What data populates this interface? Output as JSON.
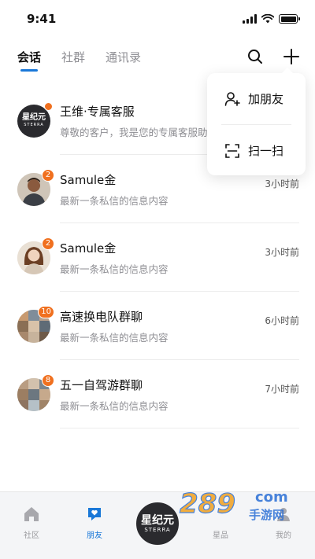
{
  "status_bar": {
    "time": "9:41"
  },
  "tabs": [
    {
      "label": "会话",
      "active": true
    },
    {
      "label": "社群",
      "active": false
    },
    {
      "label": "通讯录",
      "active": false
    }
  ],
  "header": {
    "search_icon": "search-icon",
    "add_icon": "plus-icon"
  },
  "popup_menu": {
    "items": [
      {
        "label": "加朋友",
        "icon": "add-friend-icon"
      },
      {
        "label": "扫一扫",
        "icon": "scan-icon"
      }
    ]
  },
  "chats": [
    {
      "name": "王维·专属客服",
      "message": "尊敬的客户，我是您的专属客服助",
      "time": "",
      "badge": "",
      "avatar": "sterra-logo"
    },
    {
      "name": "Samule金",
      "message": "最新一条私信的信息内容",
      "time": "3小时前",
      "badge": "2",
      "avatar": "man-photo"
    },
    {
      "name": "Samule金",
      "message": "最新一条私信的信息内容",
      "time": "3小时前",
      "badge": "2",
      "avatar": "woman-photo"
    },
    {
      "name": "高速换电队群聊",
      "message": "最新一条私信的信息内容",
      "time": "6小时前",
      "badge": "10",
      "avatar": "group-photo"
    },
    {
      "name": "五一自驾游群聊",
      "message": "最新一条私信的信息内容",
      "time": "7小时前",
      "badge": "8",
      "avatar": "group-photo"
    }
  ],
  "brand": {
    "cn": "星纪元",
    "en": "STERRA"
  },
  "tabbar": [
    {
      "label": "社区",
      "icon": "home-icon",
      "active": false
    },
    {
      "label": "朋友",
      "icon": "friends-heart-icon",
      "active": true
    },
    {
      "label": "星品",
      "icon": "",
      "active": false
    },
    {
      "label": "我的",
      "icon": "profile-icon",
      "active": false
    }
  ],
  "colors": {
    "accent": "#1a78d8",
    "badge": "#f0701f",
    "brand_dark": "#2a2a2e"
  },
  "watermark": {
    "number": "289",
    "suffix": "com",
    "text": "手游网"
  }
}
